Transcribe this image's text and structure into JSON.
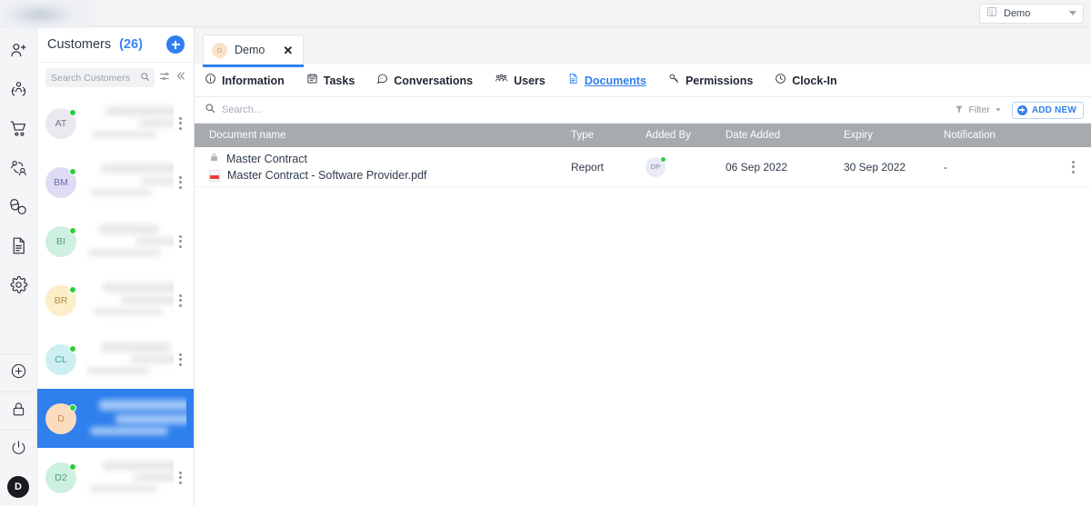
{
  "topbar": {
    "logo_alt": "company-logo",
    "org_selector": {
      "label": "Demo",
      "icon": "building-icon",
      "chevron": "chevron-down-icon"
    }
  },
  "rail": {
    "items": [
      {
        "name": "add-customer",
        "icon": "person-plus-icon"
      },
      {
        "name": "care",
        "icon": "person-in-hands-icon"
      },
      {
        "name": "orders",
        "icon": "shopping-cart-icon"
      },
      {
        "name": "staff-swap",
        "icon": "people-swap-icon"
      },
      {
        "name": "medication",
        "icon": "pills-icon"
      },
      {
        "name": "documents",
        "icon": "document-icon"
      },
      {
        "name": "settings",
        "icon": "gear-icon"
      }
    ],
    "bottom_items": [
      {
        "name": "add",
        "icon": "plus-circle-icon"
      },
      {
        "name": "lock",
        "icon": "lock-icon"
      },
      {
        "name": "logout",
        "icon": "power-icon"
      }
    ],
    "user_avatar": {
      "initials": "D"
    }
  },
  "customers": {
    "title": "Customers",
    "count": "(26)",
    "add_button": "add-customer-button",
    "search": {
      "placeholder": "Search Customers",
      "value": ""
    },
    "filter_icon": "sliders-icon",
    "collapse_icon": "double-chevron-left-icon",
    "items": [
      {
        "initials": "AT",
        "avatar_color": "#e9e9ef",
        "text_color": "#74798a",
        "online": true,
        "selected": false
      },
      {
        "initials": "BM",
        "avatar_color": "#dedcf4",
        "text_color": "#6b6cb0",
        "online": true,
        "selected": false
      },
      {
        "initials": "BI",
        "avatar_color": "#cdf0e1",
        "text_color": "#4f9c84",
        "online": true,
        "selected": false
      },
      {
        "initials": "BR",
        "avatar_color": "#fbeec8",
        "text_color": "#b49343",
        "online": true,
        "selected": false
      },
      {
        "initials": "CL",
        "avatar_color": "#cdeff0",
        "text_color": "#4d9ba2",
        "online": true,
        "selected": false
      },
      {
        "initials": "D",
        "avatar_color": "#fbdcbf",
        "text_color": "#c1895a",
        "online": true,
        "selected": true
      },
      {
        "initials": "D2",
        "avatar_color": "#cdf0e1",
        "text_color": "#4f9c84",
        "online": true,
        "selected": false
      }
    ]
  },
  "document_tab": {
    "avatar_initials": "D",
    "label": "Demo",
    "close": "✕"
  },
  "subtabs": [
    {
      "label": "Information",
      "icon": "info-circle-icon",
      "active": false
    },
    {
      "label": "Tasks",
      "icon": "calendar-icon",
      "active": false
    },
    {
      "label": "Conversations",
      "icon": "chat-bubble-icon",
      "active": false
    },
    {
      "label": "Users",
      "icon": "people-icon",
      "active": false
    },
    {
      "label": "Documents",
      "icon": "file-icon",
      "active": true
    },
    {
      "label": "Permissions",
      "icon": "key-icon",
      "active": false
    },
    {
      "label": "Clock-In",
      "icon": "clock-icon",
      "active": false
    }
  ],
  "toolbar": {
    "search": {
      "placeholder": "Search...",
      "value": "",
      "icon": "search-icon"
    },
    "filter": {
      "label": "Filter",
      "icon": "filter-icon",
      "chevron": "chevron-down-icon"
    },
    "add_new": {
      "label": "ADD NEW",
      "icon": "plus-circle-icon"
    }
  },
  "table": {
    "columns": [
      "Document name",
      "Type",
      "Added By",
      "Date Added",
      "Expiry",
      "Notification"
    ],
    "rows": [
      {
        "name": "Master Contract",
        "name_icon": "lock-icon",
        "file_name": "Master Contract - Software Provider.pdf",
        "file_icon": "pdf-icon",
        "type": "Report",
        "added_by": {
          "initials": "DP",
          "online": true
        },
        "date_added": "06 Sep 2022",
        "expiry": "30 Sep 2022",
        "notification": "-",
        "menu_icon": "kebab-menu-icon"
      }
    ]
  },
  "colors": {
    "accent": "#2f80ed",
    "header_gray": "#a7aaae",
    "online": "#2ecc40",
    "pdf_red": "#e8403a"
  }
}
